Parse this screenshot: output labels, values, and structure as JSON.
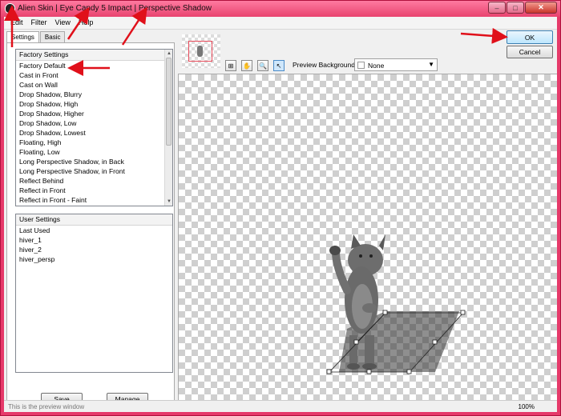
{
  "window": {
    "title": "Alien Skin | Eye Candy 5 Impact | Perspective Shadow",
    "minimize_glyph": "–",
    "maximize_glyph": "□",
    "close_glyph": "✕"
  },
  "menu": [
    "Edit",
    "Filter",
    "View",
    "Help"
  ],
  "tabs": [
    "Settings",
    "Basic"
  ],
  "factory_settings": {
    "header": "Factory Settings",
    "items": [
      "Factory Default",
      "Cast in Front",
      "Cast on Wall",
      "Drop Shadow, Blurry",
      "Drop Shadow, High",
      "Drop Shadow, Higher",
      "Drop Shadow, Low",
      "Drop Shadow, Lowest",
      "Floating, High",
      "Floating, Low",
      "Long Perspective Shadow, in Back",
      "Long Perspective Shadow, in Front",
      "Reflect Behind",
      "Reflect in Front",
      "Reflect in Front - Faint"
    ]
  },
  "user_settings": {
    "header": "User Settings",
    "items": [
      "Last Used",
      "hiver_1",
      "hiver_2",
      "hiver_persp"
    ]
  },
  "buttons": {
    "save": "Save",
    "manage": "Manage",
    "ok": "OK",
    "cancel": "Cancel"
  },
  "toolbar": {
    "preview_background_label": "Preview Background:",
    "preview_background_value": "None",
    "tools": [
      "move-preview-icon",
      "hand-icon",
      "zoom-icon",
      "pointer-icon"
    ]
  },
  "status": {
    "text": "This is the preview window",
    "zoom": "100%"
  },
  "colors": {
    "title_bar": "#e8436f",
    "annotation_arrow": "#e0101a",
    "ok_button": "#bee6fd"
  }
}
